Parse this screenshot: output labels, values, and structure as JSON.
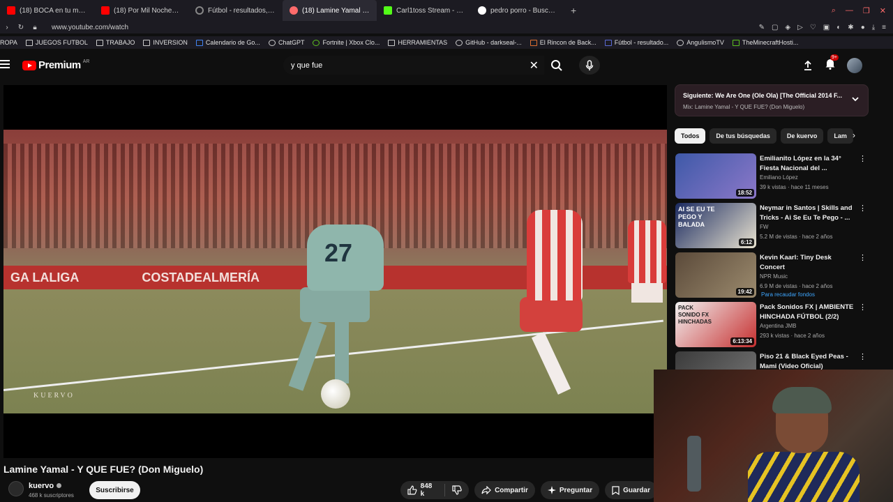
{
  "browser": {
    "tabs": [
      {
        "label": "(18) BOCA en tu municipio",
        "icon": "youtube",
        "color": "#ff0000"
      },
      {
        "label": "(18) Por Mil Noches - AIR",
        "icon": "youtube",
        "color": "#ff0000"
      },
      {
        "label": "Fútbol - resultados, calen",
        "icon": "loading",
        "color": "#888888"
      },
      {
        "label": "(18) Lamine Yamal - Y",
        "icon": "youtube",
        "color": "#ff0000"
      },
      {
        "label": "Carl1toss Stream - Watch",
        "icon": "kick",
        "color": "#53fc18"
      },
      {
        "label": "pedro porro - Buscar con",
        "icon": "google",
        "color": "#4285f4"
      }
    ],
    "url": "www.youtube.com/watch",
    "bookmarks": [
      "ROPA",
      "JUEGOS FUTBOL",
      "TRABAJO",
      "INVERSION",
      "Calendario de Go...",
      "ChatGPT",
      "Fortnite | Xbox Clo...",
      "HERRAMIENTAS",
      "GitHub - darkseal-...",
      "El Rincon de Back...",
      "Fútbol - resultado...",
      "AngulismoTV",
      "TheMinecraftHosti..."
    ]
  },
  "header": {
    "logo": "Premium",
    "region": "AR",
    "search_value": "y que fue",
    "notif_count": "9+"
  },
  "video": {
    "watermark": "KUERVO",
    "shirt_number": "27",
    "adboard": [
      "GA LALIGA",
      "COSTADEALMERÍA"
    ],
    "title": "Lamine Yamal - Y QUE FUE? (Don Miguelo)",
    "channel": "kuervo",
    "subscribers": "468 k suscriptores",
    "subscribe_label": "Suscribirse",
    "likes": "848 k",
    "share_label": "Compartir",
    "ask_label": "Preguntar",
    "save_label": "Guardar"
  },
  "up_next": {
    "title": "Siguiente: We Are One (Ole Ola) [The Official 2014 F...",
    "subtitle": "Mix: Lamine Yamal - Y QUE FUE? (Don Miguelo)"
  },
  "chips": [
    "Todos",
    "De tus búsquedas",
    "De kuervo",
    "Lam"
  ],
  "recommendations": [
    {
      "title": "Emilianito López en la 34° Fiesta Nacional del ...",
      "channel": "Emiliano López",
      "meta": "39 k vistas · hace 11 meses",
      "duration": "18:52",
      "badge": "",
      "colors": [
        "#3e59a8",
        "#8c78c9"
      ]
    },
    {
      "title": "Neymar in Santos | Skills and Tricks - Ai Se Eu Te Pego - ...",
      "channel": "FW",
      "meta": "5.2 M de vistas · hace 2 años",
      "duration": "6:12",
      "badge": "",
      "colors": [
        "#1a2a60",
        "#e9e3d0"
      ]
    },
    {
      "title": "Kevin Kaarl: Tiny Desk Concert",
      "channel": "NPR Music",
      "meta": "6.9 M de vistas · hace 2 años",
      "duration": "19:42",
      "badge": "Para recaudar fondos",
      "colors": [
        "#5b4a3a",
        "#9c8b6e"
      ]
    },
    {
      "title": "Pack Sonidos FX | AMBIENTE HINCHADA FÚTBOL (2/2)",
      "channel": "Argentina JMB",
      "meta": "293 k vistas · hace 2 años",
      "duration": "6:13:34",
      "badge": "",
      "colors": [
        "#f2f2f2",
        "#c62f2f"
      ]
    },
    {
      "title": "Piso 21 & Black Eyed Peas - Mami (Video Oficial)",
      "channel": "",
      "meta": "",
      "duration": "",
      "badge": "",
      "colors": [
        "#3b3b3b",
        "#777777"
      ]
    }
  ],
  "recommendation_thumb_texts": [
    "",
    "AI SE EU TE PEGO Y BALADA",
    "",
    "PACK SONIDO FX HINCHADAS",
    ""
  ]
}
